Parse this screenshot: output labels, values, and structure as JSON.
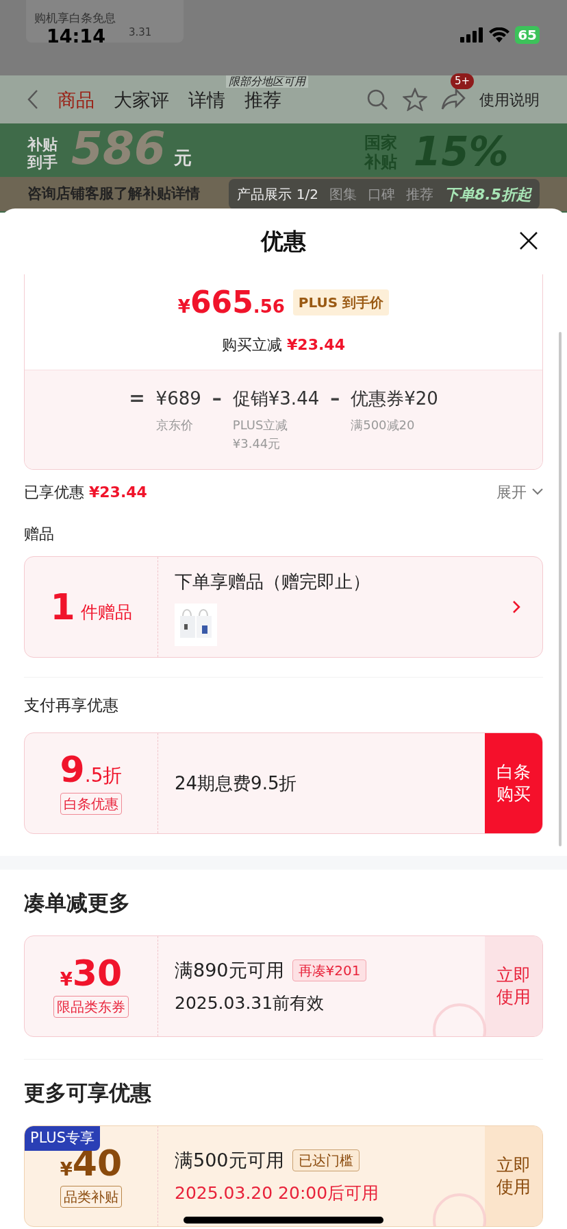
{
  "status_bar": {
    "time": "14:14",
    "battery": "65"
  },
  "background_page": {
    "promo_card": {
      "title": "购机享白条免息",
      "date": "3.31"
    },
    "nav_tabs": [
      {
        "label": "商品",
        "selected": true
      },
      {
        "label": "大家评",
        "selected": false
      },
      {
        "label": "详情",
        "selected": false
      },
      {
        "label": "推荐",
        "selected": false
      }
    ],
    "region_note": "限部分地区可用",
    "cart_badge": "5+",
    "manual_link": "使用说明",
    "banner": {
      "subsidy_label": "补贴到手",
      "amount": "586",
      "unit": "元",
      "national_label": "国家补贴",
      "percent": "15%",
      "discount": "下单8.5折起",
      "consult": "咨询店铺客服了解补贴详情"
    },
    "media_tabs": [
      {
        "label": "产品展示 1/2",
        "selected": true
      },
      {
        "label": "图集",
        "selected": false
      },
      {
        "label": "口碑",
        "selected": false
      },
      {
        "label": "推荐",
        "selected": false
      }
    ]
  },
  "sheet": {
    "title": "优惠",
    "price_card": {
      "currency": "¥",
      "integer": "665",
      "decimal": ".56",
      "price_tag": "PLUS 到手价",
      "saving_label": "购买立减",
      "saving": "¥23.44",
      "formula": [
        {
          "kind": "operator",
          "text": "="
        },
        {
          "kind": "term",
          "text": "¥689",
          "note": "京东价"
        },
        {
          "kind": "operator",
          "text": "–"
        },
        {
          "kind": "term",
          "text": "促销¥3.44",
          "note": "PLUS立减\n¥3.44元"
        },
        {
          "kind": "operator",
          "text": "–"
        },
        {
          "kind": "term",
          "text": "优惠券¥20",
          "note": "满500减20"
        }
      ]
    },
    "enjoyed": {
      "label": "已享优惠",
      "amount": "¥23.44",
      "toggle": "展开",
      "expanded": false
    },
    "gift_section": {
      "title": "赠品",
      "count": "1",
      "count_label": "件赠品",
      "description": "下单享赠品（赠完即止）"
    },
    "payment_section": {
      "title": "支付再享优惠",
      "big": "9",
      "small": ".5折",
      "tag": "白条优惠",
      "description": "24期息费9.5折",
      "action": "白条购买"
    },
    "bundle_section": {
      "title": "凑单减更多",
      "coupons": [
        {
          "kind": "store",
          "currency": "¥",
          "amount": "30",
          "tag": "限品类东券",
          "condition": "满890元可用",
          "hint": "再凑¥201",
          "validity": "2025.03.31前有效",
          "validity_alert": false,
          "action": "立即使用",
          "claimed": true
        }
      ]
    },
    "more_section": {
      "title": "更多可享优惠",
      "coupons": [
        {
          "kind": "plus",
          "badge": "PLUS专享",
          "currency": "¥",
          "amount": "40",
          "tag": "品类补贴",
          "condition": "满500元可用",
          "hint": "已达门槛",
          "validity": "2025.03.20 20:00后可用",
          "validity_alert": true,
          "action": "立即使用",
          "claimed": true
        }
      ]
    }
  }
}
